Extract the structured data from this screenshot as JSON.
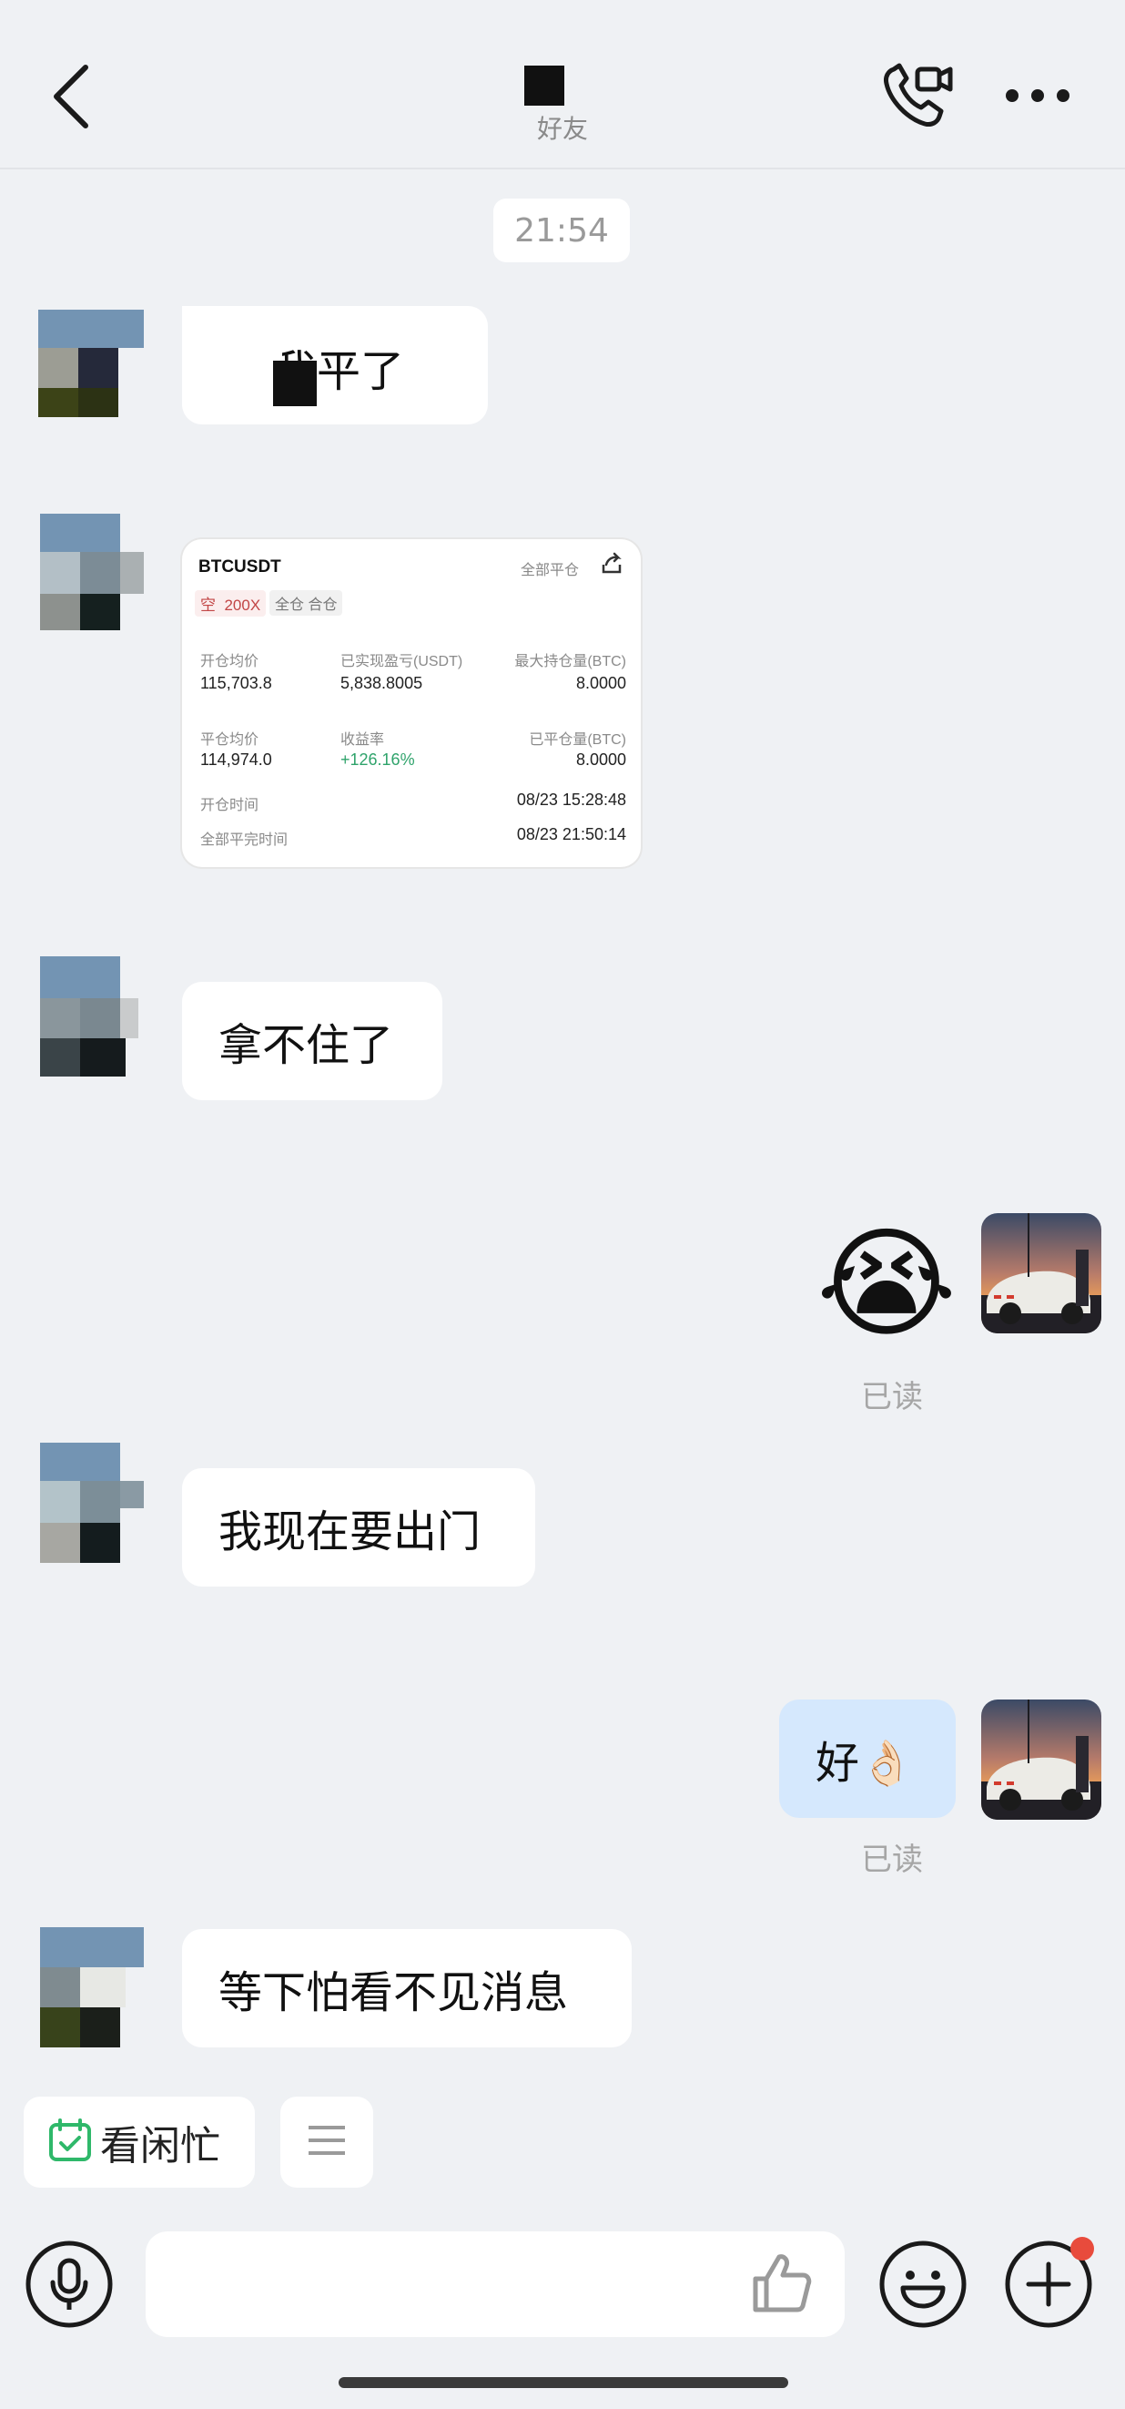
{
  "header": {
    "subtitle": "好友",
    "back_icon": "chevron-left-icon",
    "call_icon": "phone-video-icon",
    "more_icon": "more-dots-icon"
  },
  "time_divider": "21:54",
  "messages": [
    {
      "side": "left",
      "type": "text",
      "text": "我平了"
    },
    {
      "side": "left",
      "type": "trade_card"
    },
    {
      "side": "left",
      "type": "text",
      "text": "拿不住了"
    },
    {
      "side": "right",
      "type": "emoji",
      "emoji": "😭",
      "status": "已读"
    },
    {
      "side": "left",
      "type": "text",
      "text": "我现在要出门"
    },
    {
      "side": "right",
      "type": "text",
      "text": "好👌🏻",
      "status": "已读"
    },
    {
      "side": "left",
      "type": "text",
      "text": "等下怕看不见消息"
    }
  ],
  "trade_card": {
    "symbol": "BTCUSDT",
    "close_all": "全部平仓",
    "side_label": "空",
    "leverage": "200X",
    "margin_mode": "全仓 合仓",
    "open_avg_label": "开仓均价",
    "open_avg": "115,703.8",
    "realized_pnl_label": "已实现盈亏(USDT)",
    "realized_pnl": "5,838.8005",
    "max_pos_label": "最大持仓量(BTC)",
    "max_pos": "8.0000",
    "close_avg_label": "平仓均价",
    "close_avg": "114,974.0",
    "roi_label": "收益率",
    "roi": "+126.16%",
    "closed_qty_label": "已平仓量(BTC)",
    "closed_qty": "8.0000",
    "open_time_label": "开仓时间",
    "open_time": "08/23 15:28:48",
    "close_time_label": "全部平完时间",
    "close_time": "08/23 21:50:14"
  },
  "quick_actions": {
    "busy_label": "看闲忙",
    "busy_icon": "calendar-check-icon",
    "menu_icon": "menu-lines-icon"
  },
  "input_bar": {
    "voice_icon": "microphone-icon",
    "like_icon": "thumbs-up-icon",
    "emoji_icon": "smiley-icon",
    "plus_icon": "plus-icon",
    "accent": "#e84b3c"
  }
}
